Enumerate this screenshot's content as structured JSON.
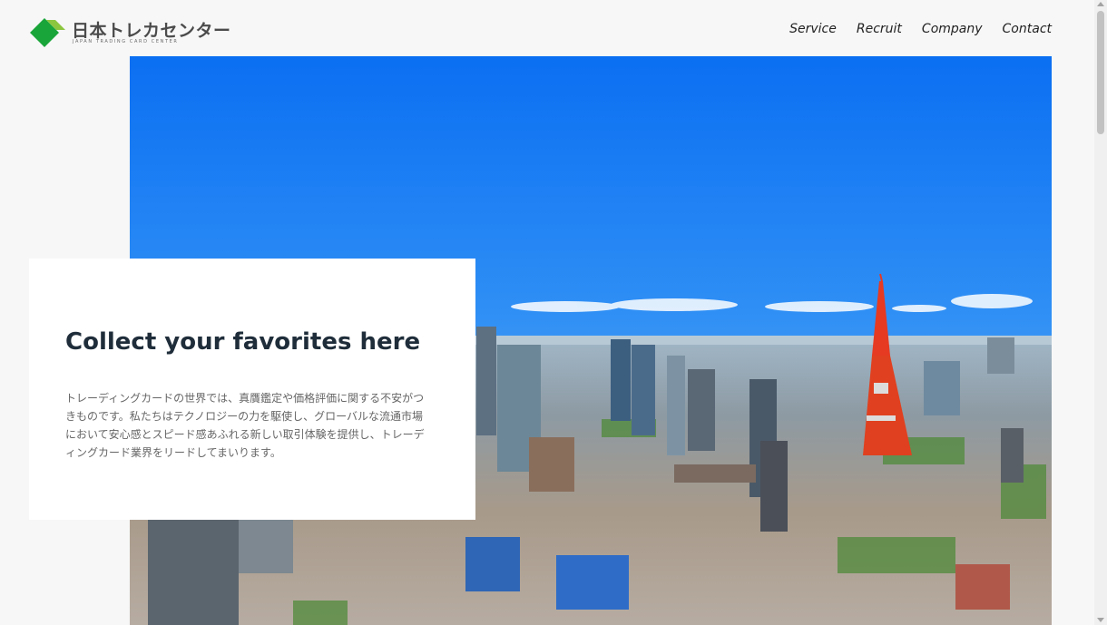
{
  "header": {
    "logo": {
      "title": "日本トレカセンター",
      "subtitle": "JAPAN TRADING CARD CENTER",
      "icon": "green-diamond-logo-icon",
      "colors": {
        "dark_green": "#1aa53a",
        "light_green": "#8cc63f"
      }
    },
    "nav": [
      {
        "label": "Service"
      },
      {
        "label": "Recruit"
      },
      {
        "label": "Company"
      },
      {
        "label": "Contact"
      }
    ]
  },
  "hero": {
    "image": "tokyo-skyline-with-tokyo-tower-photo",
    "colors": {
      "sky_top": "#0b6ff2",
      "sky_bottom": "#6fb0f0",
      "tower": "#e63a22"
    }
  },
  "card": {
    "heading": "Collect your favorites here",
    "body": "トレーディングカードの世界では、真贋鑑定や価格評価に関する不安がつきものです。私たちはテクノロジーの力を駆使し、グローバルな流通市場において安心感とスピード感あふれる新しい取引体験を提供し、トレーディングカード業界をリードしてまいります。"
  },
  "scrollbar": {
    "thumb_color": "#c2c2c2"
  }
}
